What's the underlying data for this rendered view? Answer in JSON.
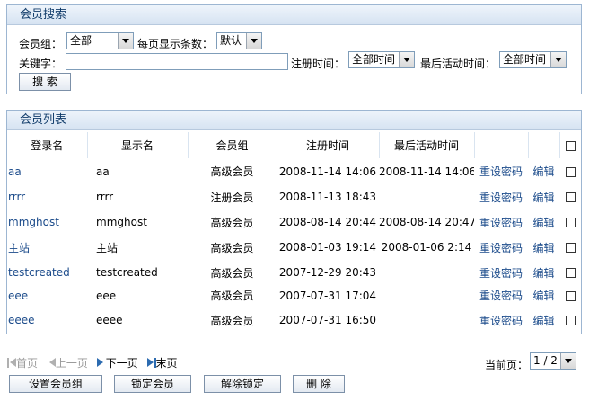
{
  "search": {
    "title": "会员搜索",
    "group_label": "会员组：",
    "group_value": "全部",
    "per_page_label": "每页显示条数：",
    "per_page_value": "默认",
    "keyword_label": "关键字：",
    "keyword_value": "",
    "reg_time_label": "注册时间：",
    "reg_time_value": "全部时间",
    "last_active_label": "最后活动时间：",
    "last_active_value": "全部时间",
    "search_button": "搜 索"
  },
  "list": {
    "title": "会员列表",
    "columns": [
      "登录名",
      "显示名",
      "会员组",
      "注册时间",
      "最后活动时间"
    ],
    "reset_label": "重设密码",
    "edit_label": "编辑",
    "rows": [
      {
        "login": "aa",
        "display": "aa",
        "group": "高级会员",
        "registered": "2008-11-14 14:06",
        "last_active": "2008-11-14 14:06"
      },
      {
        "login": "rrrr",
        "display": "rrrr",
        "group": "注册会员",
        "registered": "2008-11-13 18:43",
        "last_active": ""
      },
      {
        "login": "mmghost",
        "display": "mmghost",
        "group": "高级会员",
        "registered": "2008-08-14 20:44",
        "last_active": "2008-08-14 20:47"
      },
      {
        "login": "主站",
        "display": "主站",
        "group": "高级会员",
        "registered": "2008-01-03 19:14",
        "last_active": "2008-01-06 2:14"
      },
      {
        "login": "testcreated",
        "display": "testcreated",
        "group": "高级会员",
        "registered": "2007-12-29 20:43",
        "last_active": ""
      },
      {
        "login": "eee",
        "display": "eee",
        "group": "高级会员",
        "registered": "2007-07-31 17:04",
        "last_active": ""
      },
      {
        "login": "eeee",
        "display": "eeee",
        "group": "高级会员",
        "registered": "2007-07-31 16:50",
        "last_active": ""
      }
    ]
  },
  "pager": {
    "first": "首页",
    "prev": "上一页",
    "next": "下一页",
    "last": "末页",
    "current_label": "当前页：",
    "current_value": "1 / 2"
  },
  "actions": {
    "set_group": "设置会员组",
    "lock": "锁定会员",
    "unlock": "解除锁定",
    "delete": "删 除"
  },
  "colors": {
    "panel_border": "#9db6d2",
    "link": "#1a4a8a",
    "header_text": "#123d6b"
  }
}
